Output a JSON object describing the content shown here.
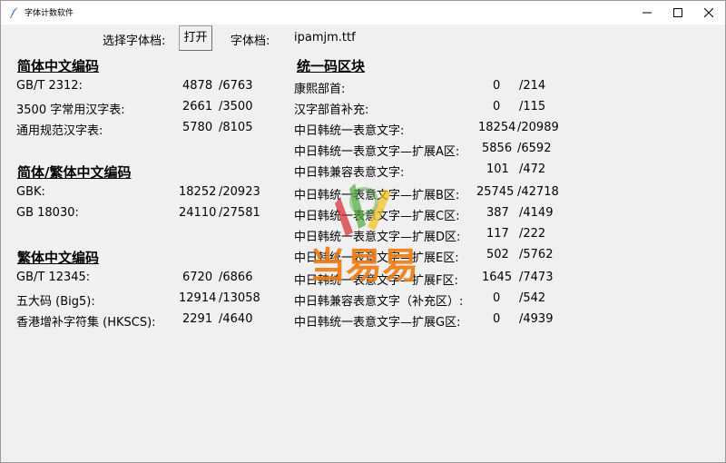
{
  "window": {
    "title": "字体计数软件"
  },
  "toolbar": {
    "choose_label": "选择字体档:",
    "open_label": "打开",
    "font_file_label": "字体档:",
    "font_file_value": "ipamjm.ttf"
  },
  "left": {
    "section1": {
      "title": "简体中文编码",
      "rows": [
        {
          "label": "GB/T 2312:",
          "count": "4878",
          "total": "/6763"
        },
        {
          "label": "3500 字常用汉字表:",
          "count": "2661",
          "total": "/3500"
        },
        {
          "label": "通用规范汉字表:",
          "count": "5780",
          "total": "/8105"
        }
      ]
    },
    "section2": {
      "title": "简体/繁体中文编码",
      "rows": [
        {
          "label": "GBK:",
          "count": "18252",
          "total": "/20923"
        },
        {
          "label": "GB 18030:",
          "count": "24110",
          "total": "/27581"
        }
      ]
    },
    "section3": {
      "title": "繁体中文编码",
      "rows": [
        {
          "label": "GB/T 12345:",
          "count": "6720",
          "total": "/6866"
        },
        {
          "label": "五大码 (Big5):",
          "count": "12914",
          "total": "/13058"
        },
        {
          "label": "香港增补字符集 (HKSCS):",
          "count": "2291",
          "total": "/4640"
        }
      ]
    }
  },
  "right": {
    "title": "统一码区块",
    "rows": [
      {
        "label": "康熙部首:",
        "count": "0",
        "total": "/214"
      },
      {
        "label": "汉字部首补充:",
        "count": "0",
        "total": "/115"
      },
      {
        "label": "中日韩统一表意文字:",
        "count": "18254",
        "total": "/20989"
      },
      {
        "label": "中日韩统一表意文字—扩展A区:",
        "count": "5856",
        "total": "/6592"
      },
      {
        "label": "中日韩兼容表意文字:",
        "count": "101",
        "total": "/472"
      },
      {
        "label": "中日韩统一表意文字—扩展B区:",
        "count": "25745",
        "total": "/42718"
      },
      {
        "label": "中日韩统一表意文字—扩展C区:",
        "count": "387",
        "total": "/4149"
      },
      {
        "label": "中日韩统一表意文字—扩展D区:",
        "count": "117",
        "total": "/222"
      },
      {
        "label": "中日韩统一表意文字—扩展E区:",
        "count": "502",
        "total": "/5762"
      },
      {
        "label": "中日韩统一表意文字—扩展F区:",
        "count": "1645",
        "total": "/7473"
      },
      {
        "label": "中日韩兼容表意文字（补充区）:",
        "count": "0",
        "total": "/542"
      },
      {
        "label": "中日韩统一表意文字—扩展G区:",
        "count": "0",
        "total": "/4939"
      }
    ]
  },
  "watermark": {
    "text": "当易易"
  },
  "icons": {
    "app": "feather-icon",
    "minimize": "minimize-icon",
    "maximize": "maximize-icon",
    "close": "close-icon"
  },
  "colors": {
    "watermark_orange": "#f07a10",
    "watermark_red": "#d4202a",
    "watermark_green": "#4aa838",
    "watermark_yellow": "#f2c21a"
  }
}
